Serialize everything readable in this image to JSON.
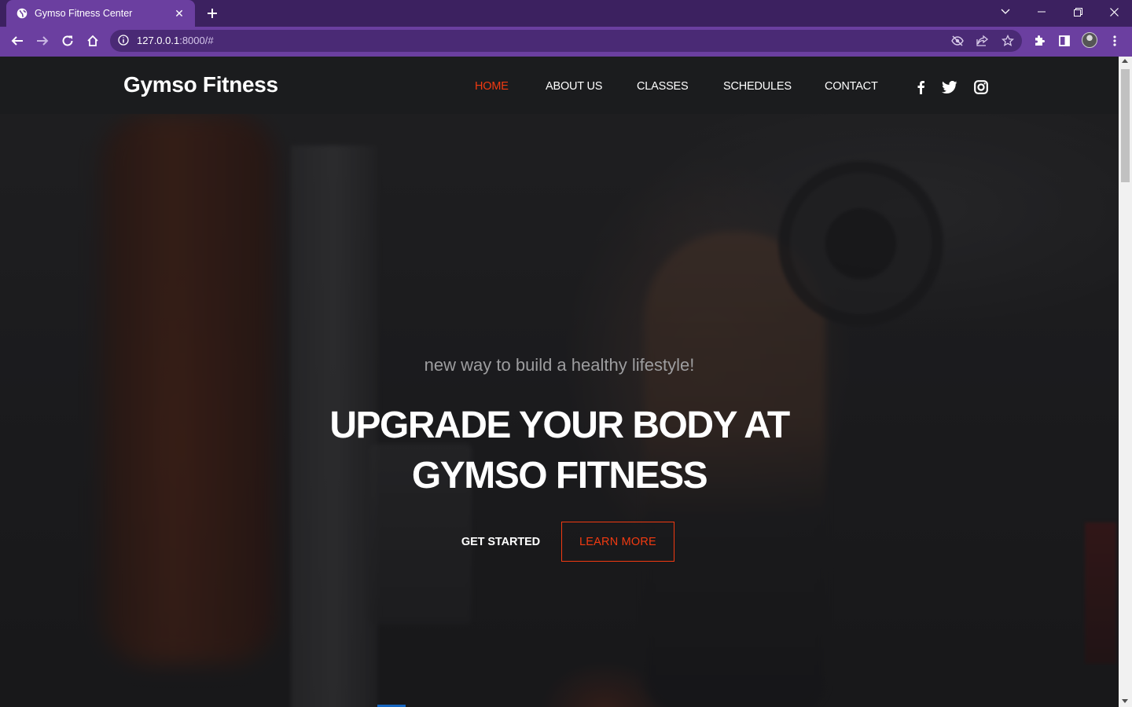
{
  "browser": {
    "tab_title": "Gymso Fitness Center",
    "url_host": "127.0.0.1",
    "url_rest": ":8000/#"
  },
  "site": {
    "brand": "Gymso Fitness",
    "nav": [
      {
        "label": "HOME",
        "active": true
      },
      {
        "label": "ABOUT US",
        "active": false
      },
      {
        "label": "CLASSES",
        "active": false
      },
      {
        "label": "SCHEDULES",
        "active": false
      },
      {
        "label": "CONTACT",
        "active": false
      }
    ],
    "social": [
      "facebook-icon",
      "twitter-icon",
      "instagram-icon"
    ]
  },
  "hero": {
    "subtitle": "new way to build a healthy lifestyle!",
    "headline_line1": "UPGRADE YOUR BODY AT",
    "headline_line2": "GYMSO FITNESS",
    "get_started": "GET STARTED",
    "learn_more": "LEARN MORE"
  },
  "colors": {
    "browser_frame": "#6b3fa0",
    "accent": "#f13a11",
    "nav_bg": "#1b1c1e"
  }
}
